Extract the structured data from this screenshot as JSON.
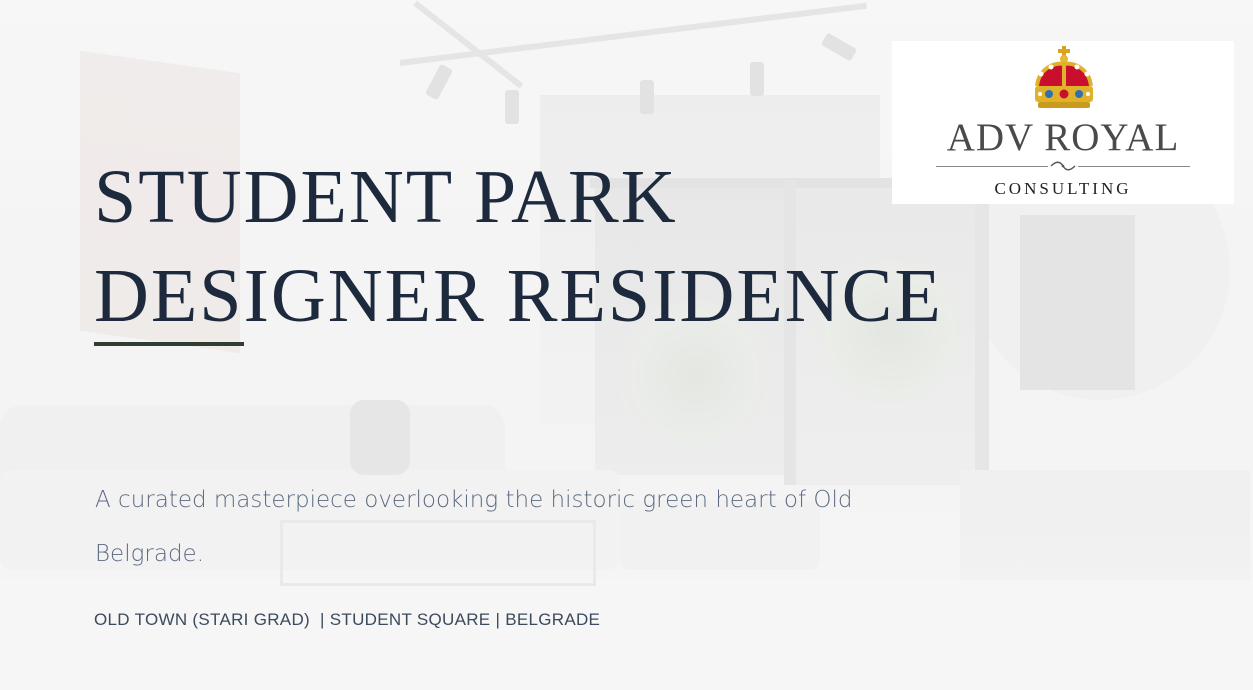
{
  "logo": {
    "icon": "crown-icon",
    "title": "ADV ROYAL",
    "subtitle": "CONSULTING"
  },
  "hero": {
    "title_line1": "STUDENT PARK",
    "title_line2": "DESIGNER RESIDENCE",
    "tagline": "A curated masterpiece overlooking the historic green heart of Old Belgrade.",
    "location": "OLD TOWN (STARI GRAD)  | STUDENT SQUARE | BELGRADE"
  },
  "colors": {
    "title": "#1d2a3d",
    "accent_line": "#2f3d33",
    "tagline": "#5c6b80",
    "location": "#3c4a5c",
    "crown_red": "#c8102e",
    "crown_gold": "#e0b22c"
  }
}
